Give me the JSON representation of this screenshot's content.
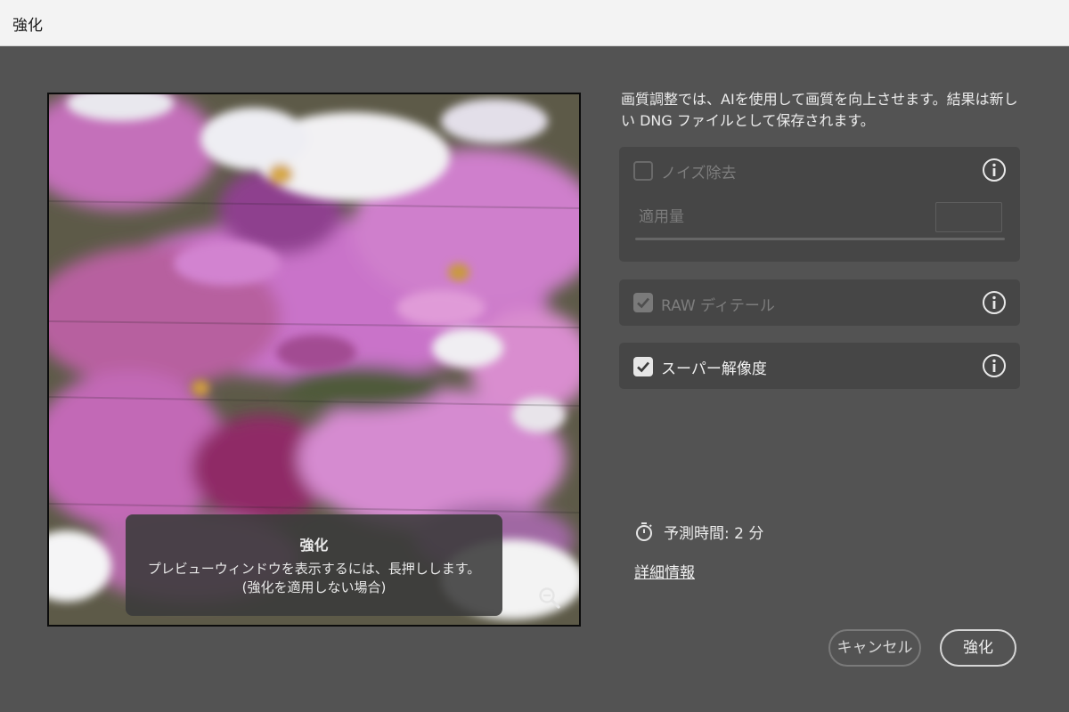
{
  "window": {
    "title": "強化"
  },
  "preview": {
    "overlay_title": "強化",
    "overlay_line1": "プレビューウィンドウを表示するには、長押しします。",
    "overlay_line2": "(強化を適用しない場合)"
  },
  "description": "画質調整では、AIを使用して画質を向上させます。結果は新しい DNG ファイルとして保存されます。",
  "options": {
    "noise_reduction": {
      "label": "ノイズ除去",
      "checked": false,
      "enabled": false,
      "amount_label": "適用量",
      "amount_value": ""
    },
    "raw_details": {
      "label": "RAW ディテール",
      "checked": true,
      "enabled": false
    },
    "super_resolution": {
      "label": "スーパー解像度",
      "checked": true,
      "enabled": true
    }
  },
  "estimate": {
    "text": "予測時間: 2 分"
  },
  "learn_more": "詳細情報",
  "buttons": {
    "cancel": "キャンセル",
    "enhance": "強化"
  },
  "icons": {
    "info": "info-icon",
    "timer": "timer-icon",
    "zoom": "zoom-out-icon",
    "check": "checkmark-icon"
  }
}
